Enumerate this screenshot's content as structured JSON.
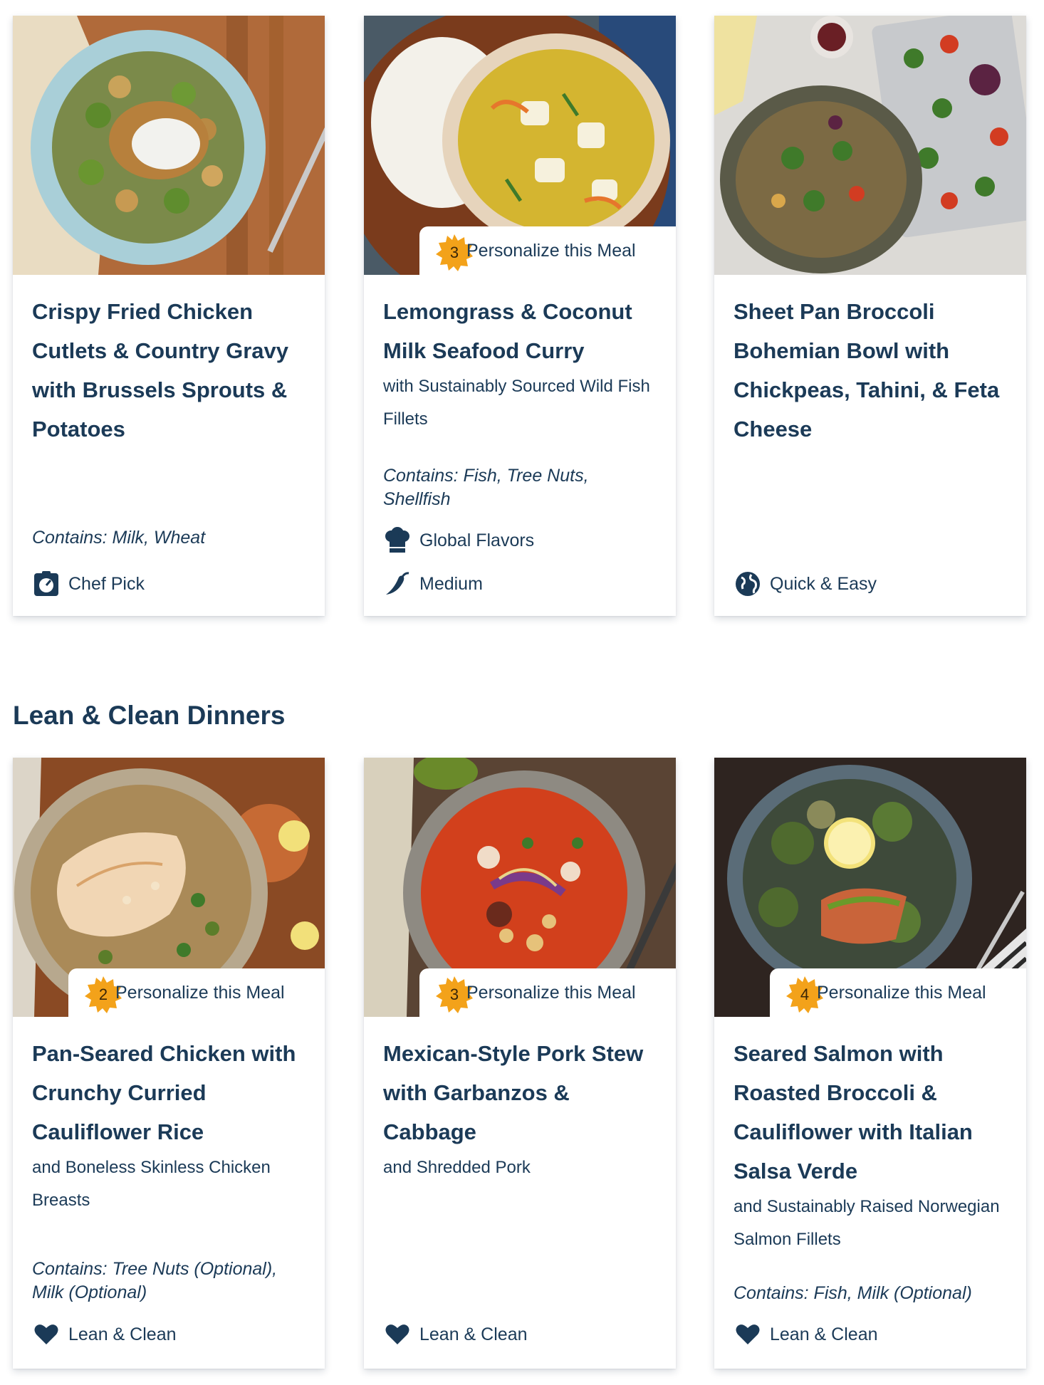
{
  "personalize_label": "Personalize this Meal",
  "section_lean_clean": "Lean & Clean Dinners",
  "cards": [
    {
      "title": "Crispy Fried Chicken Cutlets & Country Gravy with Brussels Sprouts & Potatoes",
      "contains": "Contains: Milk, Wheat",
      "tags": [
        {
          "label": "Chef Pick",
          "icon": "chef-pick-icon"
        }
      ]
    },
    {
      "title": "Lemongrass & Coconut Milk Seafood Curry",
      "subtitle": "with Sustainably Sourced Wild Fish Fillets",
      "contains": "Contains: Fish, Tree Nuts, Shellfish",
      "personalize_count": "3",
      "tags": [
        {
          "label": "Global Flavors",
          "icon": "chef-hat-icon"
        },
        {
          "label": "Medium",
          "icon": "chili-pepper-icon"
        }
      ]
    },
    {
      "title": "Sheet Pan Broccoli Bohemian Bowl with Chickpeas, Tahini, & Feta Cheese",
      "tags": [
        {
          "label": "Quick & Easy",
          "icon": "globe-icon"
        }
      ]
    },
    {
      "title": "Pan-Seared Chicken with Crunchy Curried Cauliflower Rice",
      "subtitle": "and Boneless Skinless Chicken Breasts",
      "contains": "Contains: Tree Nuts (Optional), Milk (Optional)",
      "personalize_count": "2",
      "tags": [
        {
          "label": "Lean & Clean",
          "icon": "heart-icon"
        }
      ]
    },
    {
      "title": "Mexican-Style Pork Stew with Garbanzos & Cabbage",
      "subtitle": "and Shredded Pork",
      "personalize_count": "3",
      "tags": [
        {
          "label": "Lean & Clean",
          "icon": "heart-icon"
        }
      ]
    },
    {
      "title": "Seared Salmon with Roasted Broccoli & Cauliflower with Italian Salsa Verde",
      "subtitle": "and Sustainably Raised Norwegian Salmon Fillets",
      "contains": "Contains: Fish, Milk (Optional)",
      "personalize_count": "4",
      "tags": [
        {
          "label": "Lean & Clean",
          "icon": "heart-icon"
        }
      ]
    }
  ],
  "colors": {
    "text": "#1b3a57",
    "badge": "#f3a21a"
  }
}
